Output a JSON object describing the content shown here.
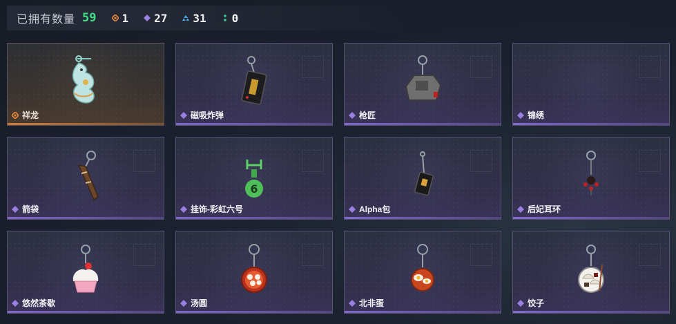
{
  "summary": {
    "label": "已拥有数量",
    "count": "59",
    "rarities": [
      {
        "icon": "orange-diamond-icon",
        "color": "#e88a3c",
        "value": "1"
      },
      {
        "icon": "purple-diamond-icon",
        "color": "#9b7fe0",
        "value": "27"
      },
      {
        "icon": "blue-triangle-icon",
        "color": "#4aa8e8",
        "value": "31"
      },
      {
        "icon": "green-dots-icon",
        "color": "#3fd0a0",
        "value": "0"
      }
    ]
  },
  "items": [
    {
      "name": "祥龙",
      "rarity": "orange",
      "icon": "dragon-charm-icon"
    },
    {
      "name": "磁吸炸弹",
      "rarity": "purple",
      "icon": "magnetic-bomb-charm-icon"
    },
    {
      "name": "枪匠",
      "rarity": "purple",
      "icon": "gunsmith-charm-icon"
    },
    {
      "name": "锦绣",
      "rarity": "purple",
      "icon": "empty-slot-icon"
    },
    {
      "name": "箭袋",
      "rarity": "purple",
      "icon": "quiver-charm-icon"
    },
    {
      "name": "挂饰-彩虹六号",
      "rarity": "purple",
      "icon": "rainbow-six-charm-icon"
    },
    {
      "name": "Alpha包",
      "rarity": "purple",
      "icon": "alpha-pack-charm-icon"
    },
    {
      "name": "后妃耳环",
      "rarity": "purple",
      "icon": "earring-charm-icon"
    },
    {
      "name": "悠然茶歇",
      "rarity": "purple",
      "icon": "cupcake-charm-icon"
    },
    {
      "name": "汤圆",
      "rarity": "purple",
      "icon": "tangyuan-charm-icon"
    },
    {
      "name": "北非蛋",
      "rarity": "purple",
      "icon": "shakshuka-charm-icon"
    },
    {
      "name": "饺子",
      "rarity": "purple",
      "icon": "dumpling-charm-icon"
    }
  ]
}
